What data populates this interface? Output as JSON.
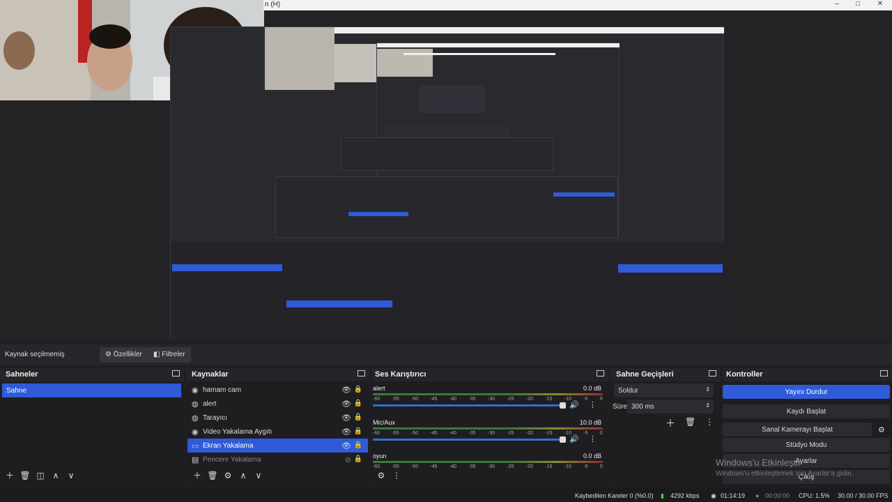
{
  "titlebar": {
    "menu_text": "n (H)",
    "minimize": "–",
    "maximize": "□",
    "close": "✕"
  },
  "source_toolbar": {
    "no_source": "Kaynak seçilmemiş",
    "properties": "Özellikler",
    "filters": "Filtreler"
  },
  "scenes": {
    "title": "Sahneler",
    "items": [
      "Sahne"
    ]
  },
  "sources": {
    "title": "Kaynaklar",
    "items": [
      {
        "name": "hamam cam",
        "icon": "camera-icon"
      },
      {
        "name": "alert",
        "icon": "globe-icon"
      },
      {
        "name": "Tarayıcı",
        "icon": "globe-icon"
      },
      {
        "name": "Video Yakalama Aygıtı",
        "icon": "camera-icon"
      },
      {
        "name": "Ekran Yakalama",
        "icon": "monitor-icon",
        "selected": true
      },
      {
        "name": "Pencere Yakalama",
        "icon": "window-icon",
        "hidden": true
      }
    ]
  },
  "mixer": {
    "title": "Ses Karıştırıcı",
    "ticks": [
      "-60",
      "-55",
      "-50",
      "-45",
      "-40",
      "-35",
      "-30",
      "-25",
      "-20",
      "-15",
      "-10",
      "-5",
      "0"
    ],
    "channels": [
      {
        "name": "alert",
        "db": "0.0 dB"
      },
      {
        "name": "Mic/Aux",
        "db": "10.0 dB"
      },
      {
        "name": "oyun",
        "db": "0.0 dB"
      }
    ]
  },
  "transitions": {
    "title": "Sahne Geçişleri",
    "type": "Soldur",
    "duration_label": "Süre",
    "duration": "300 ms"
  },
  "controls": {
    "title": "Kontroller",
    "buttons": [
      "Yayını Durdur",
      "Kaydı Başlat",
      "Sanal Kamerayı Başlat",
      "Stüdyo Modu",
      "Ayarlar",
      "Çıkış"
    ]
  },
  "status": {
    "dropped": "Kaybedilen Kareler 0 (%0.0)",
    "kbps": "4292 kbps",
    "live_time": "01:14:19",
    "rec_time": "00:00:00",
    "cpu": "CPU: 1.5%",
    "fps": "30.00 / 30.00 FPS"
  },
  "watermark": {
    "line1": "Windows'u Etkinleştir",
    "line2": "Windows'u etkinleştirmek için Ayarlar'a gidin."
  }
}
